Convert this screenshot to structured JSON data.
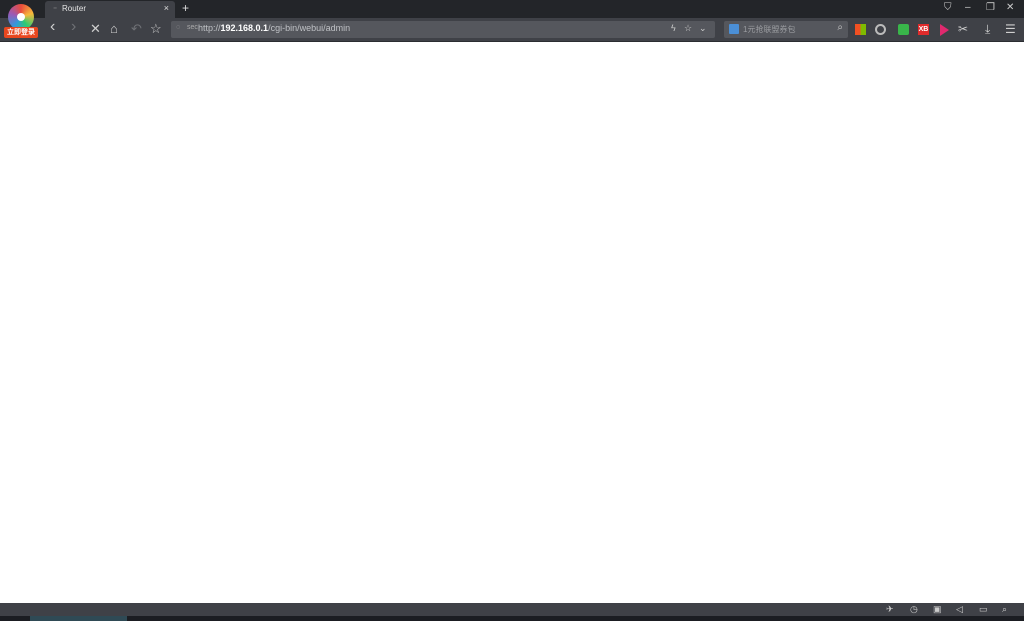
{
  "browser": {
    "logo_badge": "立即登录",
    "tab": {
      "title": "Router",
      "loading_icon": "spinner-icon",
      "close": "×"
    },
    "new_tab": "+",
    "window_controls": {
      "skin": "⛉",
      "minimize": "–",
      "restore": "❐",
      "close": "✕"
    }
  },
  "toolbar": {
    "back": "‹",
    "forward": "›",
    "stop": "✕",
    "home": "⌂",
    "undo": "↶",
    "favorite": "☆",
    "url": {
      "prefix": "http://",
      "host": "192.168.0.1",
      "path": "/cgi-bin/webui/admin",
      "security": "sec"
    },
    "url_icons": {
      "lightning": "ϟ",
      "star": "☆",
      "dropdown": "⌄"
    },
    "search": {
      "placeholder": "1元抢联盟券包",
      "glass": "⌕"
    },
    "extensions": {
      "xb_label": "XB"
    },
    "icons": {
      "cut": "✂",
      "download": "⤓",
      "menu": "☰"
    }
  },
  "statusbar": {
    "icons": {
      "rocket": "✈",
      "history": "◷",
      "trash": "▣",
      "sound": "◁",
      "window": "▭",
      "zoom": "⌕"
    }
  }
}
